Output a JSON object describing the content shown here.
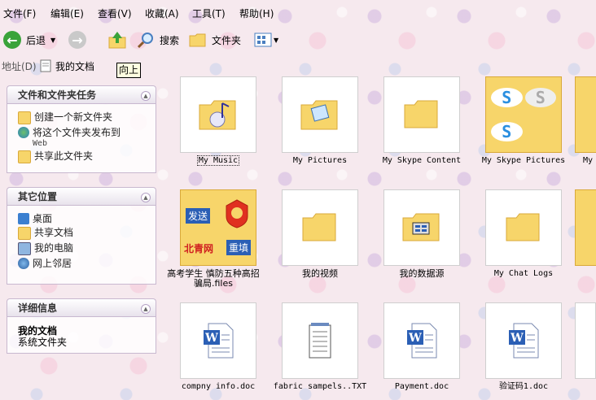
{
  "menu": [
    "文件(F)",
    "编辑(E)",
    "查看(V)",
    "收藏(A)",
    "工具(T)",
    "帮助(H)"
  ],
  "toolbar": {
    "back_label": "后退",
    "search_label": "搜索",
    "folders_label": "文件夹"
  },
  "address": {
    "label": "地址(D)",
    "value": "我的文档",
    "tooltip": "向上"
  },
  "panels": {
    "tasks": {
      "title": "文件和文件夹任务",
      "items": [
        "创建一个新文件夹",
        "将这个文件夹发布到",
        "共享此文件夹"
      ],
      "publish_suffix": "Web"
    },
    "places": {
      "title": "其它位置",
      "items": [
        "桌面",
        "共享文档",
        "我的电脑",
        "网上邻居"
      ]
    },
    "details": {
      "title": "详细信息",
      "name": "我的文档",
      "type": "系统文件夹"
    }
  },
  "files": {
    "row1": [
      "My Music",
      "My Pictures",
      "My Skype Content",
      "My Skype Pictures",
      "My"
    ],
    "row2": [
      "高考学生  慎防五种高招骗局.files",
      "我的视频",
      "我的数据源",
      "My Chat Logs"
    ],
    "row2_badges": [
      "发送",
      "重填",
      "北青网"
    ],
    "row3": [
      "compny info.doc",
      "fabric sampels..TXT",
      "Payment.doc",
      "验证码1.doc"
    ]
  },
  "colors": {
    "folder": "#f7d56a",
    "folder_dark": "#d9a93a",
    "back_green": "#3aa33a",
    "word_blue": "#2b5fb5",
    "panel_border": "#c8b8cf"
  }
}
